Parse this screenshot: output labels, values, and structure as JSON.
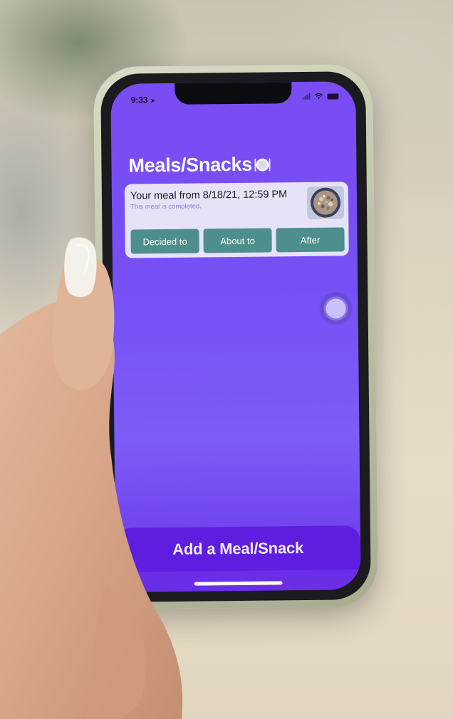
{
  "status_bar": {
    "time": "9:33",
    "icons": [
      "location-arrow-icon",
      "signal-icon",
      "wifi-icon",
      "battery-icon"
    ]
  },
  "header": {
    "title": "Meals/Snacks",
    "icon": "plate-utensils-icon"
  },
  "meal_card": {
    "title": "Your meal from 8/18/21, 12:59 PM",
    "subtitle": "This meal is completed.",
    "thumbnail_icon": "meal-photo",
    "buttons": [
      {
        "label": "Decided to"
      },
      {
        "label": "About to"
      },
      {
        "label": "After"
      }
    ]
  },
  "assistive_touch": {
    "icon": "assistive-touch-icon"
  },
  "bottom_bar": {
    "add_label": "Add a Meal/Snack"
  },
  "colors": {
    "screen_bg": "#7650f5",
    "card_bg": "#e7e3f7",
    "button_bg": "#4d8f8c",
    "bottom_bar_bg": "#5f1de0"
  }
}
